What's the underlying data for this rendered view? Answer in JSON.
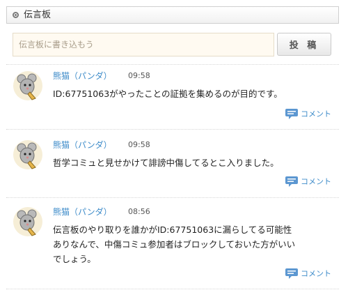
{
  "header": {
    "title": "伝言板"
  },
  "post": {
    "placeholder": "伝言板に書き込もう",
    "button_label": "投 稿"
  },
  "entries": [
    {
      "author": "熊猫（パンダ）",
      "time": "09:58",
      "text": "ID:67751063がやったことの証拠を集めるのが目的です。",
      "comment_label": "コメント"
    },
    {
      "author": "熊猫（パンダ）",
      "time": "09:58",
      "text": "哲学コミュと見せかけて誹謗中傷してるとこ入りました。",
      "comment_label": "コメント"
    },
    {
      "author": "熊猫（パンダ）",
      "time": "08:56",
      "text_lines": [
        "伝言板のやり取りを誰かがID:67751063に漏らしてる可能性",
        "ありなんで、中傷コミュ参加者はブロックしておいた方がいい",
        "でしょう。"
      ],
      "comment_label": "コメント"
    }
  ],
  "colors": {
    "link": "#3d8bc9",
    "input_bg": "#fffaf1",
    "comment_icon": "#4f8fcf"
  },
  "icons": {
    "header": "radio-circle-icon",
    "avatar": "mouse-avatar-icon",
    "comment": "speech-bubble-icon"
  }
}
